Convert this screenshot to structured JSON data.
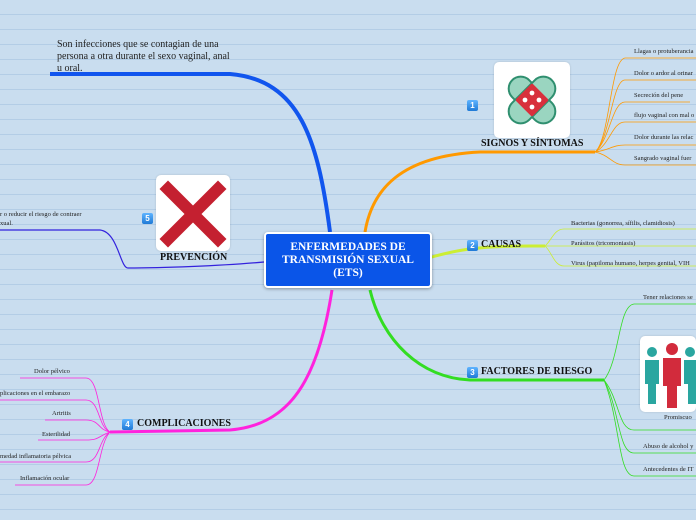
{
  "central": {
    "title": "ENFERMEDADES DE\nTRANSMISIÓN SEXUAL\n(ETS)",
    "color": "#0a55e8"
  },
  "definition": "Son infecciones que se contagian de una persona a otra durante el sexo vaginal, anal u oral.",
  "branches": {
    "signos": {
      "number": "1",
      "title": "SIGNOS Y SÍNTOMAS",
      "color": "#ff9900",
      "icon": "bandage-icon",
      "items": [
        "Llagas o protuberancia",
        "Dolor o ardor al orinar",
        "Secreción del pene",
        "flujo vaginal con mal o",
        "Dolor durante las relac",
        "Sangrado vaginal fuer"
      ]
    },
    "causas": {
      "number": "2",
      "title": "CAUSAS",
      "color": "#ccee33",
      "items": [
        "Bacterias (gonorrea, sífilis, clamidiosis)",
        "Parásitos (tricomoniasis)",
        "Virus (papiloma humano, herpes genital, VIH"
      ]
    },
    "factores": {
      "number": "3",
      "title": "FACTORES DE RIESGO",
      "color": "#33dd22",
      "icon": "people-icon",
      "items": [
        "Tener relaciones se",
        "Promiscuo",
        "Abuso de alcohol y",
        "Antecedentes de IT"
      ]
    },
    "complicaciones": {
      "number": "4",
      "title": "COMPLICACIONES",
      "color": "#ff22dd",
      "items": [
        "Dolor pélvico",
        "plicaciones en el embarazo",
        "Artritis",
        "Esterilidad",
        "medad inflamatoria pélvica",
        "Inflamación ocular"
      ]
    },
    "prevencion": {
      "number": "5",
      "title": "PREVENCIÓN",
      "color": "#3322dd",
      "icon": "red-x-icon",
      "text_line1": "r o reducir el riesgo de contraer",
      "text_line2": "xual."
    }
  },
  "definition_line_color": "#1155ee"
}
